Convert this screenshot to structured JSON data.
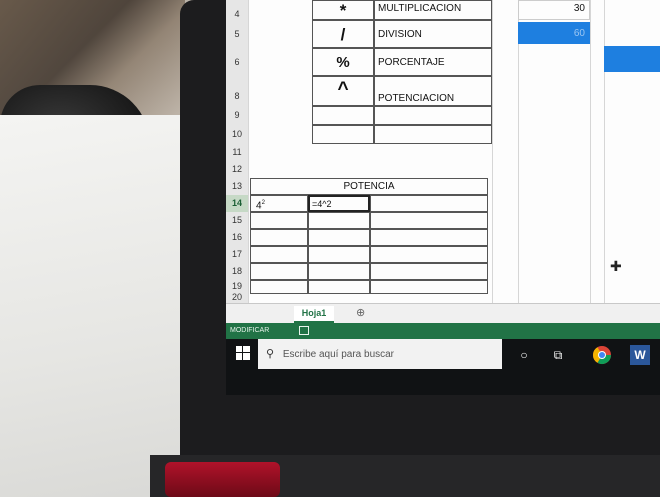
{
  "spreadsheet": {
    "operators_table": [
      {
        "row": "4",
        "symbol": "*",
        "label": "MULTIPLICACION",
        "value": "30"
      },
      {
        "row": "5",
        "symbol": "/",
        "label": "DIVISION",
        "value": "60"
      },
      {
        "row": "6",
        "symbol": "%",
        "label": "PORCENTAJE",
        "value": ""
      },
      {
        "row": "8",
        "symbol": "^",
        "label": "POTENCIACION",
        "value": ""
      }
    ],
    "empty_rows": [
      "9",
      "10",
      "11",
      "12"
    ],
    "potencia_title_row": "13",
    "potencia_title": "POTENCIA",
    "active_row": "14",
    "potencia_example": "4",
    "potencia_exponent": "2",
    "potencia_formula": "=4^2",
    "lower_rows": [
      "15",
      "16",
      "17",
      "18",
      "19",
      "20"
    ],
    "sheet_tab": "Hoja1",
    "add_sheet": "⊕",
    "status_mode": "MODIFICAR"
  },
  "taskbar": {
    "search_placeholder": "Escribe aquí para buscar"
  },
  "colors": {
    "excel_green": "#217346",
    "selection_blue": "#1e7fe0"
  },
  "icons": [
    "windows-icon",
    "search-icon",
    "cortana-icon",
    "task-view-icon",
    "chrome-icon",
    "word-icon",
    "cross-cursor-icon"
  ]
}
